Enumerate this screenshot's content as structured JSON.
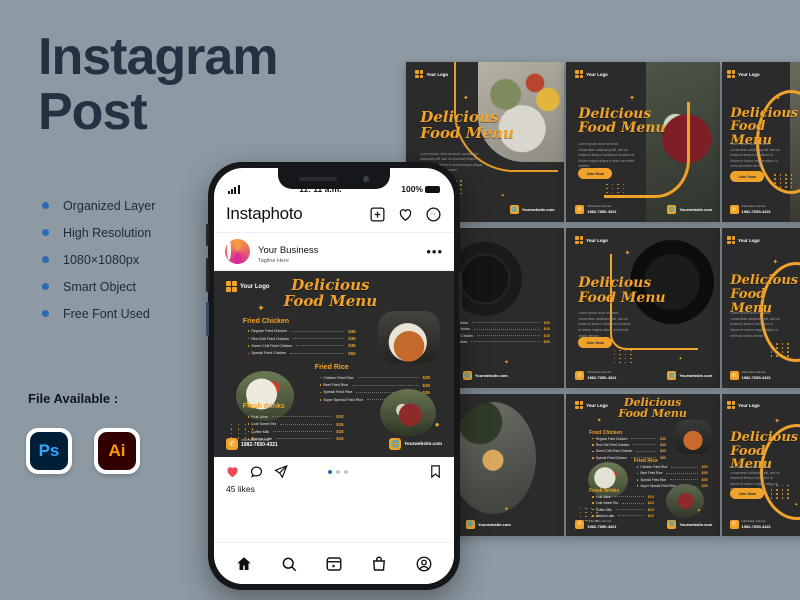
{
  "page": {
    "background_color": "#8d99a3",
    "headline_line1": "Instagram",
    "headline_line2": "Post",
    "headline_color": "#243140"
  },
  "features": {
    "bullet_color": "#2b6cb5",
    "items": [
      {
        "label": "Organized Layer"
      },
      {
        "label": "High Resolution"
      },
      {
        "label": "1080×1080px"
      },
      {
        "label": "Smart Object"
      },
      {
        "label": "Free Font Used"
      }
    ]
  },
  "file_available": {
    "label": "File Available :",
    "files": [
      {
        "name": "photoshop",
        "abbr": "Ps",
        "bg": "#001e36",
        "fg": "#31a8ff"
      },
      {
        "name": "illustrator",
        "abbr": "Ai",
        "bg": "#330000",
        "fg": "#ff9a00"
      }
    ]
  },
  "phone": {
    "statusbar": {
      "time": "11: 11 a.m.",
      "battery": "100%"
    },
    "app": {
      "logo": "Instaphoto",
      "icons": [
        "plus-box-icon",
        "heart-icon",
        "messenger-icon"
      ]
    },
    "profile": {
      "name": "Your Business",
      "tagline": "Tagline Here",
      "menu": "•••"
    },
    "actions": {
      "like_icon": "heart-filled-icon",
      "comment_icon": "comment-icon",
      "share_icon": "share-icon",
      "save_icon": "bookmark-icon",
      "likes": "45 likes",
      "carousel_dots": 3,
      "carousel_active": 0
    },
    "tabbar": [
      "home-icon",
      "search-icon",
      "reels-icon",
      "shop-icon",
      "profile-icon"
    ]
  },
  "brand": {
    "accent": "#f0a32a",
    "dark": "#2b2b2b",
    "logo_text": "Your Logo",
    "title_line1": "Delicious",
    "title_line2": "Food Menu",
    "cta": "Join Now",
    "lorem": "Lorem ipsum dolor sit amet, consectetur adipiscing elit, sed do eiusmod tempor incididunt ut labore et dolore magna aliqua ut enim ad minim veniam.",
    "call_label": "Information call now",
    "phone_number": "1982-7650-4321",
    "website": "Yourwebsite.com"
  },
  "menu": {
    "sections": [
      {
        "heading": "Fried Chicken",
        "items": [
          {
            "name": "Regular Fried Chicken",
            "price": "$35"
          },
          {
            "name": "Red Chili Fried Chicken",
            "price": "$35"
          },
          {
            "name": "Green Chili Fried Chicken",
            "price": "$35"
          },
          {
            "name": "Special Fried Chicken",
            "price": "$55"
          }
        ]
      },
      {
        "heading": "Fried Rice",
        "items": [
          {
            "name": "Chicken Fried Rice",
            "price": "$25"
          },
          {
            "name": "Beef Fried Rice",
            "price": "$35"
          },
          {
            "name": "Special Fried Rice",
            "price": "$35"
          },
          {
            "name": "Super Special Fried Rice",
            "price": "$45"
          }
        ]
      },
      {
        "heading": "Fresh drinks",
        "items": [
          {
            "name": "Fruit Juice",
            "price": "$10"
          },
          {
            "name": "Cold Sweet Tea",
            "price": "$15"
          },
          {
            "name": "Coffee Milk",
            "price": "$15"
          },
          {
            "name": "Matcha Latte",
            "price": "$15"
          }
        ]
      }
    ]
  },
  "templates": [
    {
      "id": "tpl-1",
      "variant": "hero-salad",
      "has_cta": false,
      "has_phone_footer": false,
      "has_web_footer": true,
      "has_body": true,
      "has_menu": false
    },
    {
      "id": "tpl-2",
      "variant": "hero-drink",
      "has_cta": true,
      "has_phone_footer": true,
      "has_web_footer": true,
      "has_body": true,
      "has_menu": false
    },
    {
      "id": "tpl-3",
      "variant": "hero-partial",
      "has_cta": true,
      "has_phone_footer": true,
      "has_web_footer": false,
      "has_body": true,
      "has_menu": false
    },
    {
      "id": "tpl-4",
      "variant": "menu-chicken",
      "has_cta": false,
      "has_phone_footer": false,
      "has_web_footer": true,
      "has_body": false,
      "has_menu": true
    },
    {
      "id": "tpl-5",
      "variant": "hero-plate",
      "has_cta": true,
      "has_phone_footer": true,
      "has_web_footer": true,
      "has_body": true,
      "has_menu": false
    },
    {
      "id": "tpl-6",
      "variant": "hero-partial2",
      "has_cta": false,
      "has_phone_footer": false,
      "has_web_footer": false,
      "has_body": true,
      "has_menu": false
    },
    {
      "id": "tpl-7",
      "variant": "photo-coffee",
      "has_cta": false,
      "has_phone_footer": false,
      "has_web_footer": true,
      "has_body": true,
      "has_menu": false
    },
    {
      "id": "tpl-8",
      "variant": "full-menu",
      "has_cta": false,
      "has_phone_footer": true,
      "has_web_footer": true,
      "has_body": false,
      "has_menu": true
    },
    {
      "id": "tpl-9",
      "variant": "hero-partial3",
      "has_cta": true,
      "has_phone_footer": true,
      "has_web_footer": false,
      "has_body": true,
      "has_menu": false
    }
  ]
}
